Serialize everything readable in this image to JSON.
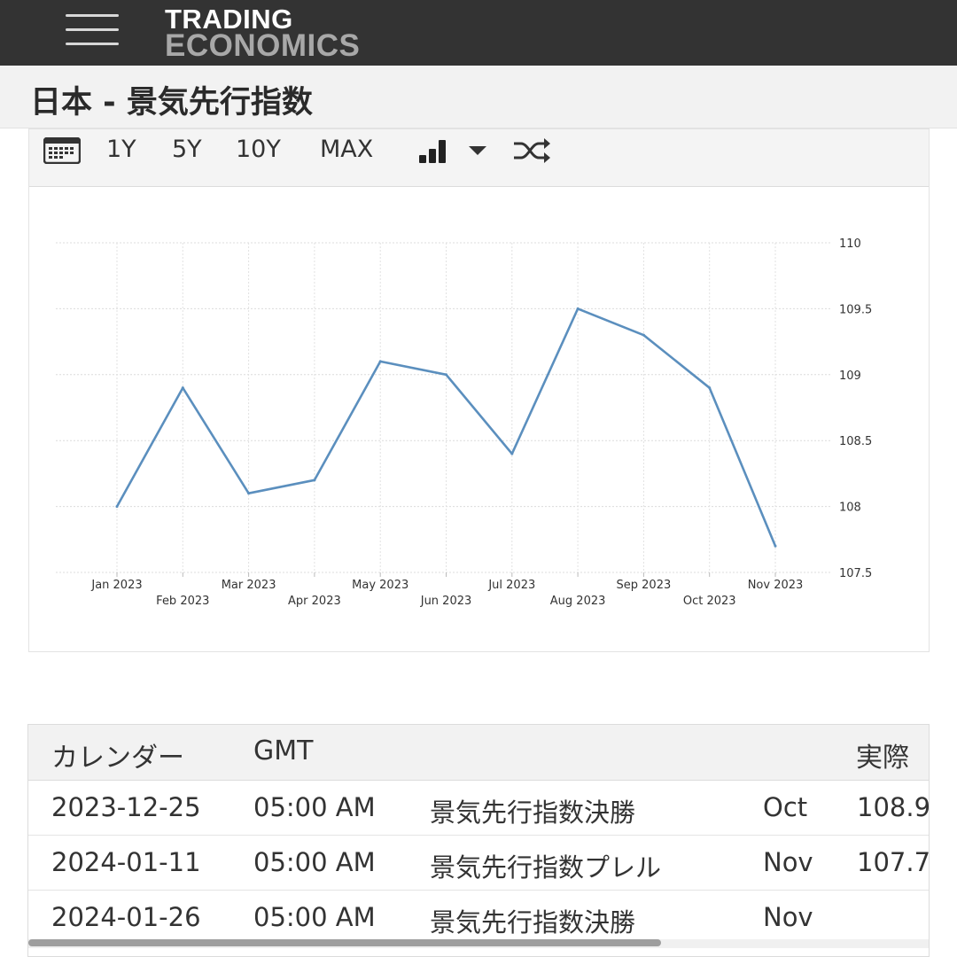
{
  "header": {
    "logo_line1": "TRADING",
    "logo_line2": "ECONOMICS",
    "menu_icon": "hamburger-menu-icon"
  },
  "page": {
    "title": "日本 - 景気先行指数"
  },
  "toolbar": {
    "calendar_icon": "calendar-icon",
    "range_1y": "1Y",
    "range_5y": "5Y",
    "range_10y": "10Y",
    "range_max": "MAX",
    "chart_type_icon": "bar-chart-icon",
    "dropdown_icon": "caret-down-icon",
    "compare_icon": "shuffle-icon"
  },
  "chart_data": {
    "type": "line",
    "title": "",
    "xlabel": "",
    "ylabel": "",
    "x": [
      "Jan 2023",
      "Feb 2023",
      "Mar 2023",
      "Apr 2023",
      "May 2023",
      "Jun 2023",
      "Jul 2023",
      "Aug 2023",
      "Sep 2023",
      "Oct 2023",
      "Nov 2023"
    ],
    "series": [
      {
        "values": [
          108.0,
          108.9,
          108.1,
          108.2,
          109.1,
          109.0,
          108.4,
          109.5,
          109.3,
          108.9,
          107.7
        ]
      }
    ],
    "ylim": [
      107.5,
      110
    ],
    "yticks": [
      "107.5",
      "108",
      "108.5",
      "109",
      "109.5",
      "110"
    ],
    "y_axis_side": "right",
    "grid": true,
    "line_color": "#5b8fbe"
  },
  "calendar_table": {
    "headers": [
      "カレンダー",
      "GMT",
      "",
      "",
      "実際"
    ],
    "rows": [
      [
        "2023-12-25",
        "05:00 AM",
        "景気先行指数決勝",
        "Oct",
        "108.9"
      ],
      [
        "2024-01-11",
        "05:00 AM",
        "景気先行指数プレル",
        "Nov",
        "107.7"
      ],
      [
        "2024-01-26",
        "05:00 AM",
        "景気先行指数決勝",
        "Nov",
        ""
      ]
    ]
  }
}
